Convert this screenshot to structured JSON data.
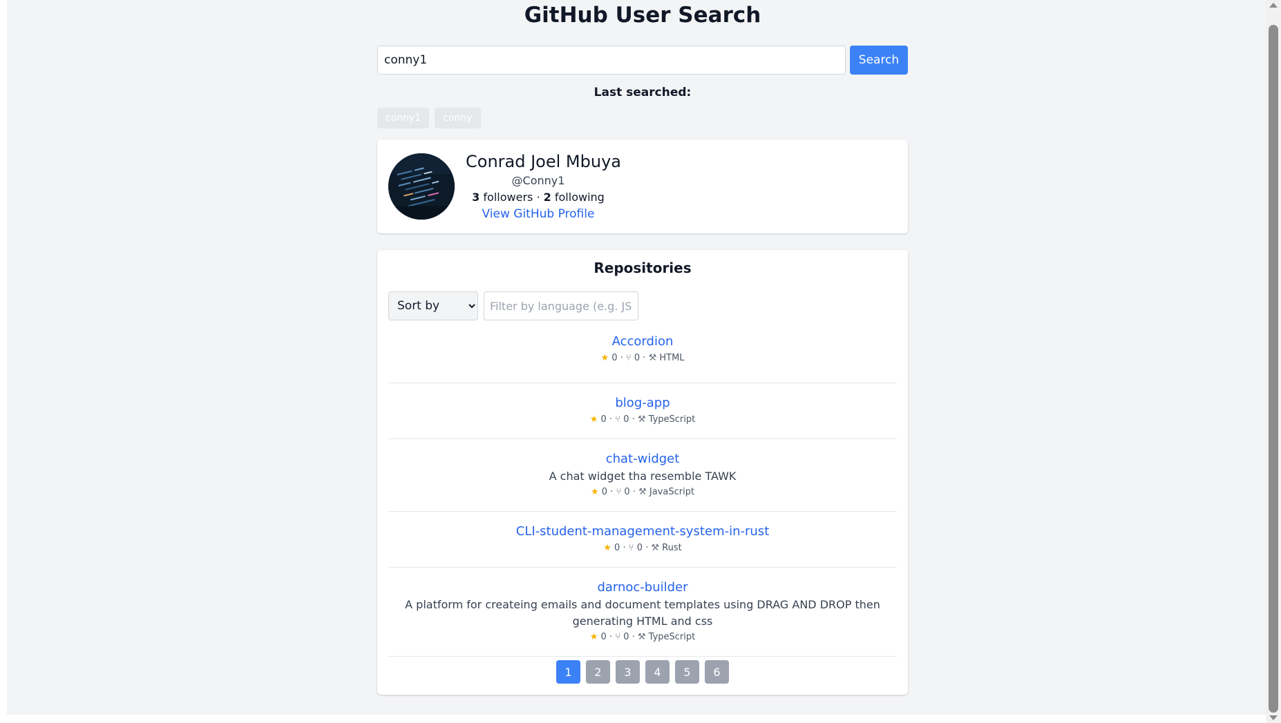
{
  "header": {
    "title": "GitHub User Search"
  },
  "search": {
    "value": "conny1",
    "button_label": "Search"
  },
  "history": {
    "label": "Last searched:",
    "items": [
      "conny1",
      "conny"
    ]
  },
  "profile": {
    "name": "Conrad Joel Mbuya",
    "login": "@Conny1",
    "followers_count": "3",
    "followers_label": "followers",
    "separator": "·",
    "following_count": "2",
    "following_label": "following",
    "link_label": "View GitHub Profile"
  },
  "repos": {
    "title": "Repositories",
    "sort_label": "Sort by",
    "filter_placeholder": "Filter by language (e.g. JS, Python)",
    "items": [
      {
        "name": "Accordion",
        "description": "",
        "stars": "0",
        "forks": "0",
        "language": "HTML"
      },
      {
        "name": "blog-app",
        "description": "",
        "stars": "0",
        "forks": "0",
        "language": "TypeScript"
      },
      {
        "name": "chat-widget",
        "description": "A chat widget tha resemble TAWK",
        "stars": "0",
        "forks": "0",
        "language": "JavaScript"
      },
      {
        "name": "CLI-student-management-system-in-rust",
        "description": "",
        "stars": "0",
        "forks": "0",
        "language": "Rust"
      },
      {
        "name": "darnoc-builder",
        "description": "A platform for createing emails and document templates using DRAG AND DROP then generating HTML and css",
        "stars": "0",
        "forks": "0",
        "language": "TypeScript"
      }
    ]
  },
  "pagination": {
    "pages": [
      "1",
      "2",
      "3",
      "4",
      "5",
      "6"
    ],
    "current": "1"
  },
  "icons": {
    "star": "star-icon",
    "fork": "fork-icon",
    "language": "tools-icon"
  },
  "colors": {
    "accent": "#3b82f6",
    "link": "#2563eb",
    "page_inactive": "#9ca3af"
  }
}
